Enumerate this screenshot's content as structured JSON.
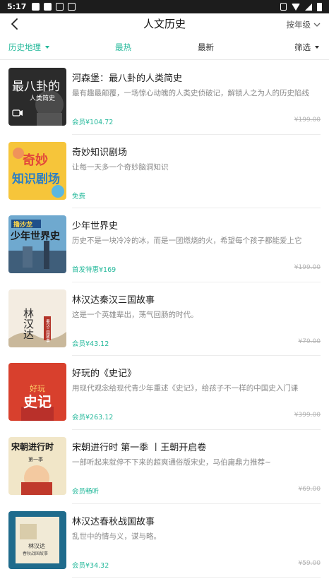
{
  "status": {
    "time": "5:17"
  },
  "nav": {
    "title": "人文历史",
    "grade_filter": "按年级"
  },
  "filters": {
    "category": "历史地理",
    "hot": "最热",
    "newest": "最新",
    "sift": "筛选"
  },
  "items": [
    {
      "title": "河森堡：最八卦的人类简史",
      "desc": "最有趣最颠覆，一场惊心动魄的人类史侦破记，解锁人之为人的历史陷线",
      "price": "会员¥104.72",
      "original": "¥199.00",
      "cover": {
        "line1": "最八卦的",
        "line2": "人类简史",
        "bg": "#2b2b2b"
      }
    },
    {
      "title": "奇妙知识剧场",
      "desc": "让每一天多一个奇妙脑洞知识",
      "price": "免费",
      "original": "",
      "cover": {
        "line1": "奇妙",
        "line2": "知识剧场",
        "bg": "#f6c53a"
      }
    },
    {
      "title": "少年世界史",
      "desc": "历史不是一块冷冷的冰，而是一团燃烧的火，希望每个孩子都能爱上它",
      "price": "首发特惠¥169",
      "original": "¥199.00",
      "cover": {
        "line1": "撸沙龙",
        "line2": "少年世界史",
        "bg": "#6fa9cf"
      }
    },
    {
      "title": "林汉达秦汉三国故事",
      "desc": "这是一个英雄辈出，荡气回肠的时代。",
      "price": "会员¥43.12",
      "original": "¥79.00",
      "cover": {
        "line1": "林汉达",
        "line2": "秦汉三国故事",
        "bg": "#f3ece1"
      }
    },
    {
      "title": "好玩的《史记》",
      "desc": "用现代观念给现代青少年重述《史记》，给孩子不一样的中国史入门课",
      "price": "会员¥263.12",
      "original": "¥399.00",
      "cover": {
        "line1": "好玩",
        "line2": "史记",
        "bg": "#d8402d"
      }
    },
    {
      "title": "宋朝进行时 第一季 丨王朝开启卷",
      "desc": "一部听起来就停不下来的超爽通俗版宋史，马伯庸鼎力推荐~",
      "price": "会员畅听",
      "original": "¥69.00",
      "cover": {
        "line1": "宋朝进行时",
        "line2": "第一季",
        "bg": "#f1e6c8"
      }
    },
    {
      "title": "林汉达春秋战国故事",
      "desc": "乱世中的情与义，谋与略。",
      "price": "会员¥34.32",
      "original": "¥59.00",
      "cover": {
        "line1": "林汉达",
        "line2": "春秋战国故事",
        "bg": "#1f6b8c"
      }
    }
  ],
  "colors": {
    "accent": "#23b89a",
    "muted": "#8a8a8a",
    "strike": "#b5b5b5"
  }
}
